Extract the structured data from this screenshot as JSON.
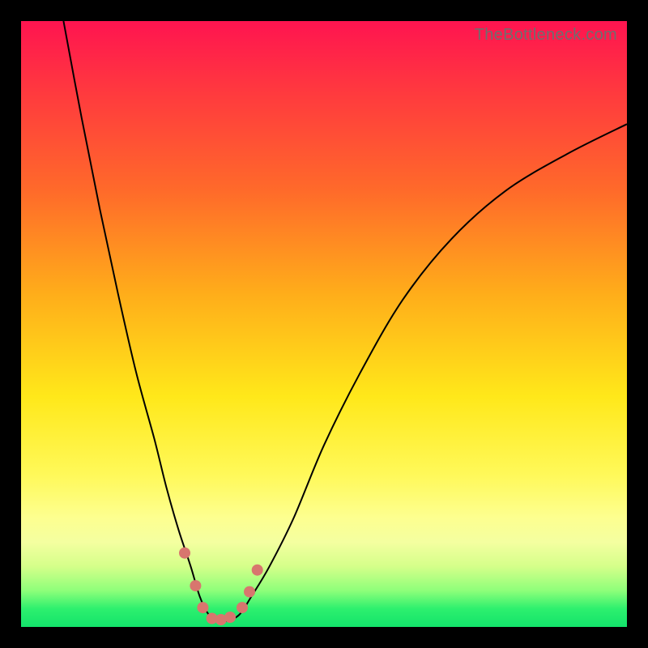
{
  "watermark": "TheBottleneck.com",
  "chart_data": {
    "type": "line",
    "title": "",
    "xlabel": "",
    "ylabel": "",
    "xlim": [
      0,
      100
    ],
    "ylim": [
      0,
      100
    ],
    "series": [
      {
        "name": "bottleneck-curve",
        "x": [
          7,
          10,
          13,
          16,
          19,
          22,
          24,
          26,
          28,
          29.5,
          31,
          32.5,
          34,
          36,
          38,
          41,
          45,
          50,
          56,
          63,
          71,
          80,
          90,
          100
        ],
        "y": [
          100,
          84,
          69,
          55,
          42,
          31,
          23,
          16,
          10,
          5,
          2,
          1,
          1,
          2,
          5,
          10,
          18,
          30,
          42,
          54,
          64,
          72,
          78,
          83
        ]
      }
    ],
    "markers": {
      "name": "highlight-dots",
      "color": "#d8766e",
      "x": [
        27.0,
        28.8,
        30.0,
        31.5,
        33.0,
        34.5,
        36.5,
        37.7,
        39.0
      ],
      "y": [
        12.2,
        6.8,
        3.2,
        1.4,
        1.2,
        1.6,
        3.2,
        5.8,
        9.4
      ]
    },
    "gradient_stops": [
      {
        "pos": 0,
        "color": "#ff1450"
      },
      {
        "pos": 12,
        "color": "#ff3a3e"
      },
      {
        "pos": 28,
        "color": "#ff6a2a"
      },
      {
        "pos": 45,
        "color": "#ffad1a"
      },
      {
        "pos": 62,
        "color": "#ffe81a"
      },
      {
        "pos": 75,
        "color": "#fff95a"
      },
      {
        "pos": 82,
        "color": "#fdff90"
      },
      {
        "pos": 86,
        "color": "#f4ffa0"
      },
      {
        "pos": 90,
        "color": "#d5ff8a"
      },
      {
        "pos": 94,
        "color": "#8eff7a"
      },
      {
        "pos": 97,
        "color": "#2df06e"
      },
      {
        "pos": 100,
        "color": "#13e36b"
      }
    ]
  }
}
